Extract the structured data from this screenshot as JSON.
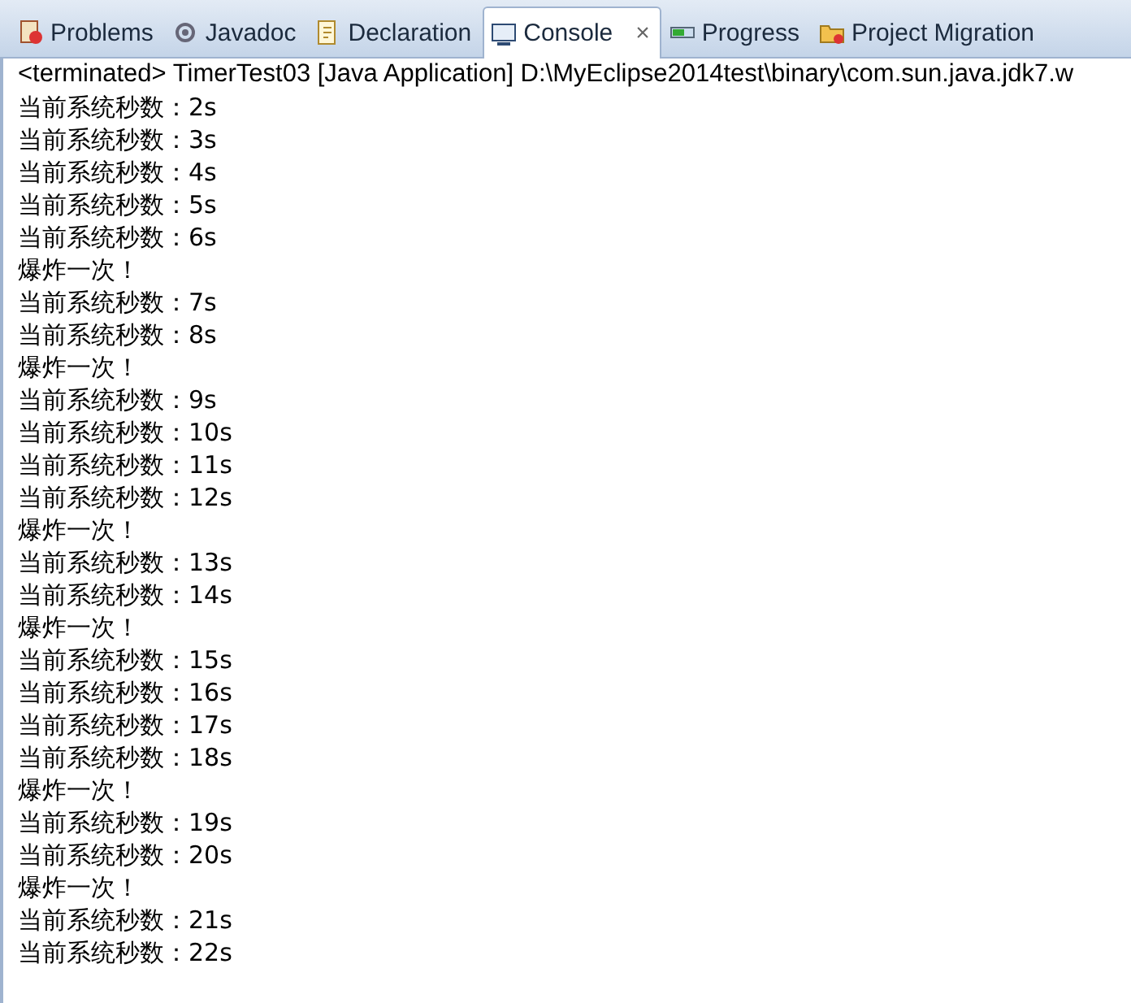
{
  "tabs": [
    {
      "label": "Problems",
      "kind": "problems",
      "selected": false
    },
    {
      "label": "Javadoc",
      "kind": "javadoc",
      "selected": false
    },
    {
      "label": "Declaration",
      "kind": "declaration",
      "selected": false
    },
    {
      "label": "Console",
      "kind": "console",
      "selected": true,
      "close": "×"
    },
    {
      "label": "Progress",
      "kind": "progress",
      "selected": false
    },
    {
      "label": "Project Migration",
      "kind": "migration",
      "selected": false
    }
  ],
  "console": {
    "header": "<terminated> TimerTest03 [Java Application] D:\\MyEclipse2014test\\binary\\com.sun.java.jdk7.w",
    "lines": [
      "当前系统秒数：2s",
      "当前系统秒数：3s",
      "当前系统秒数：4s",
      "当前系统秒数：5s",
      "当前系统秒数：6s",
      "爆炸一次！",
      "当前系统秒数：7s",
      "当前系统秒数：8s",
      "爆炸一次！",
      "当前系统秒数：9s",
      "当前系统秒数：10s",
      "当前系统秒数：11s",
      "当前系统秒数：12s",
      "爆炸一次！",
      "当前系统秒数：13s",
      "当前系统秒数：14s",
      "爆炸一次！",
      "当前系统秒数：15s",
      "当前系统秒数：16s",
      "当前系统秒数：17s",
      "当前系统秒数：18s",
      "爆炸一次！",
      "当前系统秒数：19s",
      "当前系统秒数：20s",
      "爆炸一次！",
      "当前系统秒数：21s",
      "当前系统秒数：22s"
    ]
  }
}
